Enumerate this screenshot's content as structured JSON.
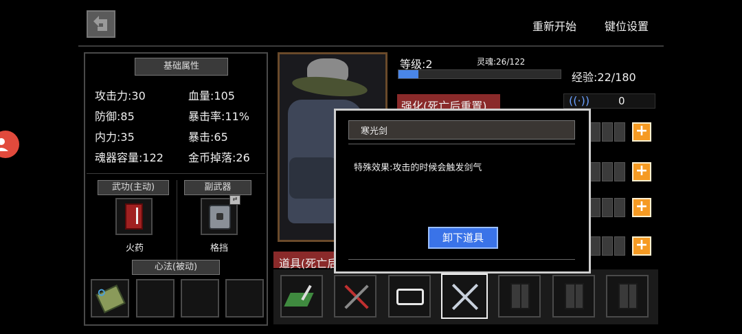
{
  "top": {
    "restart": "重新开始",
    "keybind": "键位设置"
  },
  "attrs": {
    "header": "基础属性",
    "rows": [
      [
        "攻击力:30",
        "血量:105"
      ],
      [
        "防御:85",
        "暴击率:11%"
      ],
      [
        "内力:35",
        "暴击:65"
      ],
      [
        "魂器容量:122",
        "金币掉落:26"
      ]
    ]
  },
  "martial": {
    "header": "武功(主动)",
    "name": "火药"
  },
  "sub_weapon": {
    "header": "副武器",
    "name": "格挡"
  },
  "mind": {
    "header": "心法(被动)"
  },
  "level": {
    "label": "等级:2",
    "soul": "灵魂:26/122",
    "exp": "经验:22/180",
    "exp_progress": 0.122
  },
  "enhance": {
    "label": "强化(死亡后重置)",
    "count": "0"
  },
  "items": {
    "label": "道具(死亡后"
  },
  "popup": {
    "title": "寒光剑",
    "effect": "特殊效果:攻击的时候会触发剑气",
    "button": "卸下道具"
  },
  "colors": {
    "accent_orange": "#f59a23",
    "button_blue": "#3a73e8",
    "enhance_red": "#8a2a2a"
  }
}
